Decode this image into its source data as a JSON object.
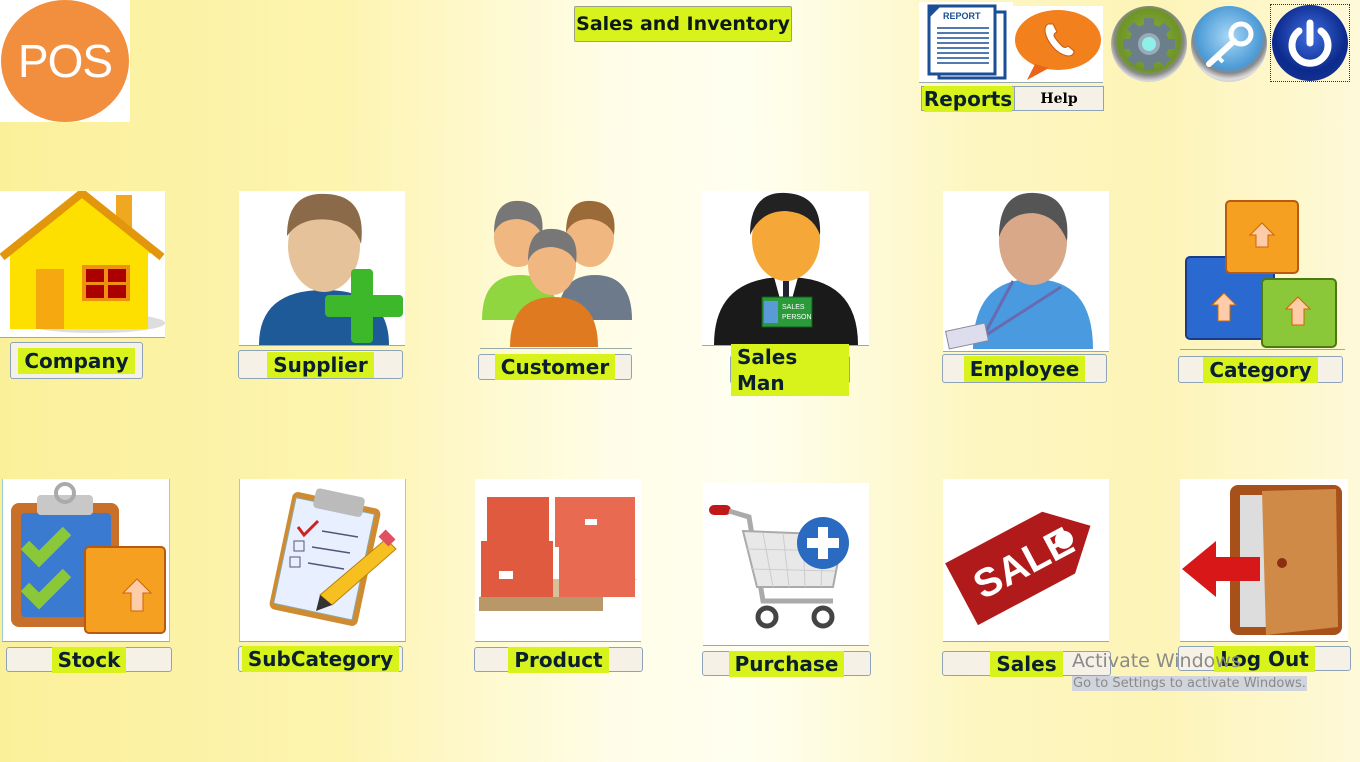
{
  "app": {
    "logo_text": "POS",
    "title": "Sales and Inventory"
  },
  "toolbar": {
    "reports_label": "Reports",
    "report_icon_text": "REPORT",
    "help_label": "Help",
    "settings_icon": "gear-icon",
    "password_icon": "key-icon",
    "power_icon": "power-icon"
  },
  "modules": [
    {
      "label": "Company",
      "icon": "house-icon"
    },
    {
      "label": "Supplier",
      "icon": "user-add-icon"
    },
    {
      "label": "Customer",
      "icon": "users-group-icon"
    },
    {
      "label": "Sales Man",
      "icon": "salesperson-icon",
      "badge_text_1": "SALES",
      "badge_text_2": "PERSON"
    },
    {
      "label": "Employee",
      "icon": "employee-icon"
    },
    {
      "label": "Category",
      "icon": "boxes-icon"
    },
    {
      "label": "Stock",
      "icon": "clipboard-box-icon"
    },
    {
      "label": "SubCategory",
      "icon": "clipboard-pencil-icon"
    },
    {
      "label": "Product",
      "icon": "pallet-boxes-icon"
    },
    {
      "label": "Purchase",
      "icon": "cart-add-icon"
    },
    {
      "label": "Sales",
      "icon": "sale-tag-icon",
      "tag_text": "SALE"
    },
    {
      "label": "Log Out",
      "icon": "exit-door-icon"
    }
  ],
  "watermark": {
    "line1": "Activate Windows",
    "line2": "Go to Settings to activate Windows."
  },
  "colors": {
    "label_highlight": "#d8f21c",
    "logo_orange": "#f18f3f"
  }
}
